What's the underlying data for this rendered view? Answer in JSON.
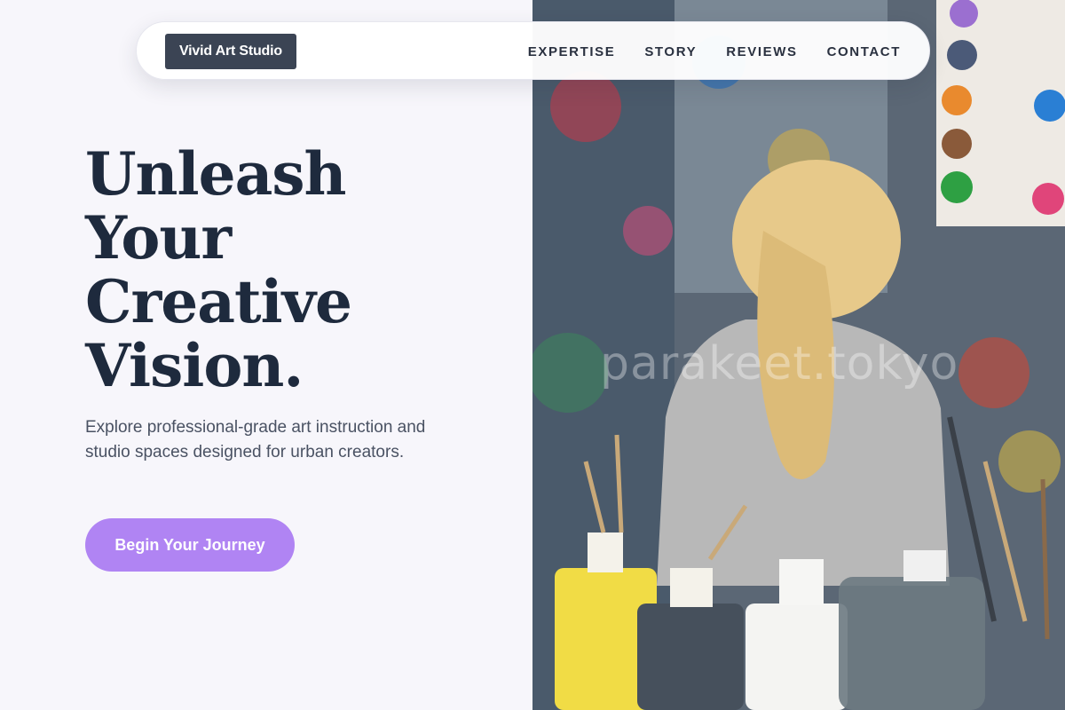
{
  "brand": {
    "name": "Vivid Art Studio"
  },
  "nav": {
    "items": [
      "EXPERTISE",
      "STORY",
      "REVIEWS",
      "CONTACT"
    ]
  },
  "hero": {
    "headline_lines": [
      "Unleash",
      "Your",
      "Creative",
      "Vision."
    ],
    "subtext": "Explore professional-grade art instruction and studio spaces designed for urban creators.",
    "cta_label": "Begin Your Journey"
  },
  "photo": {
    "watermark": "parakeet.tokyo"
  },
  "colors": {
    "accent": "#b084f3",
    "brand_bg": "#3b4454",
    "headline": "#1e2a3d",
    "page_bg": "#f7f6fb"
  }
}
